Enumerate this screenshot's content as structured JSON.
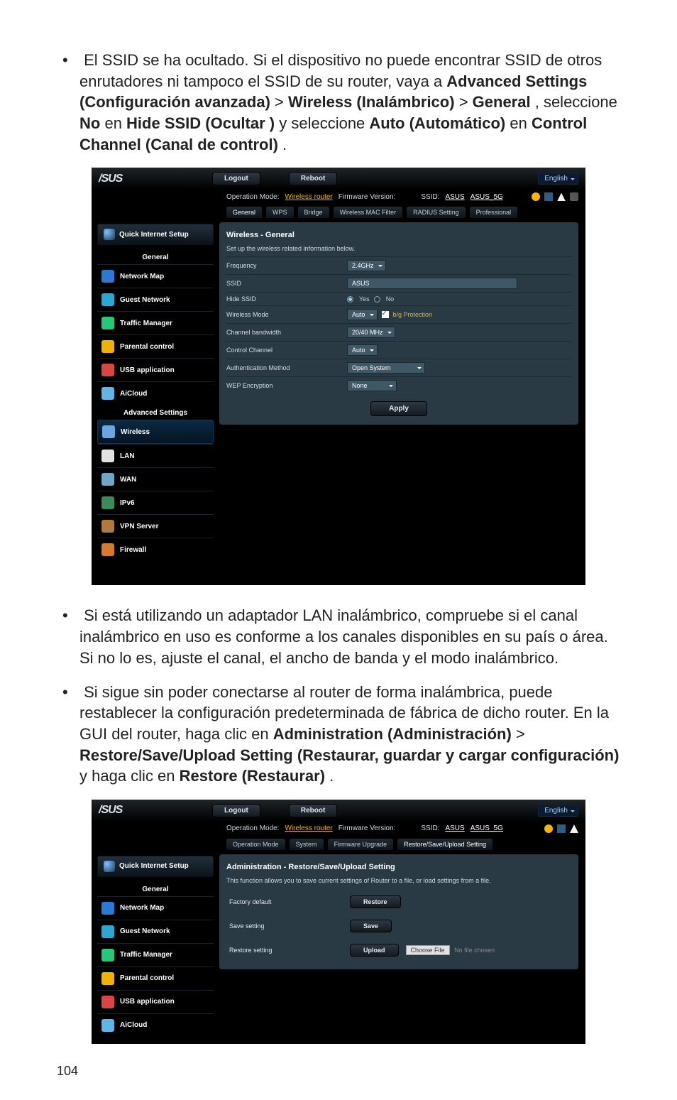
{
  "bullets": {
    "b1_pre": "El SSID se ha ocultado. Si el dispositivo no puede encontrar SSID de otros enrutadores ni tampoco el SSID de su router, vaya a ",
    "b1_adv": "Advanced Settings (Configuración avanzada)",
    "b1_gt1": " > ",
    "b1_wireless": "Wireless (Inalámbrico)",
    "b1_gt2": " > ",
    "b1_general": "General",
    "b1_sel": ", seleccione ",
    "b1_no": "No",
    "b1_en": " en ",
    "b1_hide": "Hide SSID (Ocultar )",
    "b1_and": " y seleccione ",
    "b1_auto": "Auto (Automático)",
    "b1_en2": " en ",
    "b1_cc": "Control Channel (Canal de control)",
    "b1_dot": ".",
    "b2": "Si está utilizando un adaptador LAN inalámbrico, compruebe si el canal inalámbrico en uso es conforme a los canales disponibles en su país o área. Si no lo es, ajuste el canal, el ancho de banda y el modo inalámbrico.",
    "b3_pre": "Si sigue sin poder conectarse al router de forma inalámbrica, puede restablecer la configuración predeterminada de fábrica de dicho router. En la GUI del router, haga clic en ",
    "b3_admin": "Administration (Administración)",
    "b3_gt": " > ",
    "b3_rsu": "Restore/Save/Upload Setting (Restaurar, guardar y cargar configuración)",
    "b3_and": " y haga clic en ",
    "b3_restore": "Restore (Restaurar)",
    "b3_dot": "."
  },
  "ui1": {
    "logo": "/SUS",
    "logout": "Logout",
    "reboot": "Reboot",
    "language": "English",
    "opmode_lbl": "Operation Mode:",
    "opmode_val": "Wireless router",
    "fw_lbl": "Firmware Version:",
    "ssid_lbl": "SSID:",
    "ssid1": "ASUS",
    "ssid2": "ASUS_5G",
    "tabs": [
      "General",
      "WPS",
      "Bridge",
      "Wireless MAC Filter",
      "RADIUS Setting",
      "Professional"
    ],
    "qis": "Quick Internet Setup",
    "sect_general": "General",
    "nav": [
      "Network Map",
      "Guest Network",
      "Traffic Manager",
      "Parental control",
      "USB application",
      "AiCloud"
    ],
    "sect_adv": "Advanced Settings",
    "nav_adv": [
      "Wireless",
      "LAN",
      "WAN",
      "IPv6",
      "VPN Server",
      "Firewall"
    ],
    "panel_title": "Wireless - General",
    "panel_sub": "Set up the wireless related information below.",
    "rows": {
      "freq": {
        "lbl": "Frequency",
        "val": "2.4GHz"
      },
      "ssid": {
        "lbl": "SSID",
        "val": "ASUS"
      },
      "hide": {
        "lbl": "Hide SSID",
        "yes": "Yes",
        "no": "No"
      },
      "mode": {
        "lbl": "Wireless Mode",
        "val": "Auto",
        "bg": "b/g Protection"
      },
      "bw": {
        "lbl": "Channel bandwidth",
        "val": "20/40 MHz"
      },
      "chan": {
        "lbl": "Control Channel",
        "val": "Auto"
      },
      "auth": {
        "lbl": "Authentication Method",
        "val": "Open System"
      },
      "wep": {
        "lbl": "WEP Encryption",
        "val": "None"
      }
    },
    "apply": "Apply"
  },
  "ui2": {
    "logo": "/SUS",
    "logout": "Logout",
    "reboot": "Reboot",
    "language": "English",
    "opmode_lbl": "Operation Mode:",
    "opmode_val": "Wireless router",
    "fw_lbl": "Firmware Version:",
    "ssid_lbl": "SSID:",
    "ssid1": "ASUS",
    "ssid2": "ASUS_5G",
    "tabs": [
      "Operation Mode",
      "System",
      "Firmware Upgrade",
      "Restore/Save/Upload Setting"
    ],
    "qis": "Quick Internet Setup",
    "sect_general": "General",
    "nav": [
      "Network Map",
      "Guest Network",
      "Traffic Manager",
      "Parental control",
      "USB application",
      "AiCloud"
    ],
    "panel_title": "Administration - Restore/Save/Upload Setting",
    "panel_sub": "This function allows you to save current settings of Router to a file, or load settings from a file.",
    "rows": {
      "factory": {
        "lbl": "Factory default",
        "btn": "Restore"
      },
      "save": {
        "lbl": "Save setting",
        "btn": "Save"
      },
      "restore": {
        "lbl": "Restore setting",
        "btn": "Upload",
        "choose": "Choose File",
        "nofile": "No file chosen"
      }
    }
  },
  "page": "104"
}
